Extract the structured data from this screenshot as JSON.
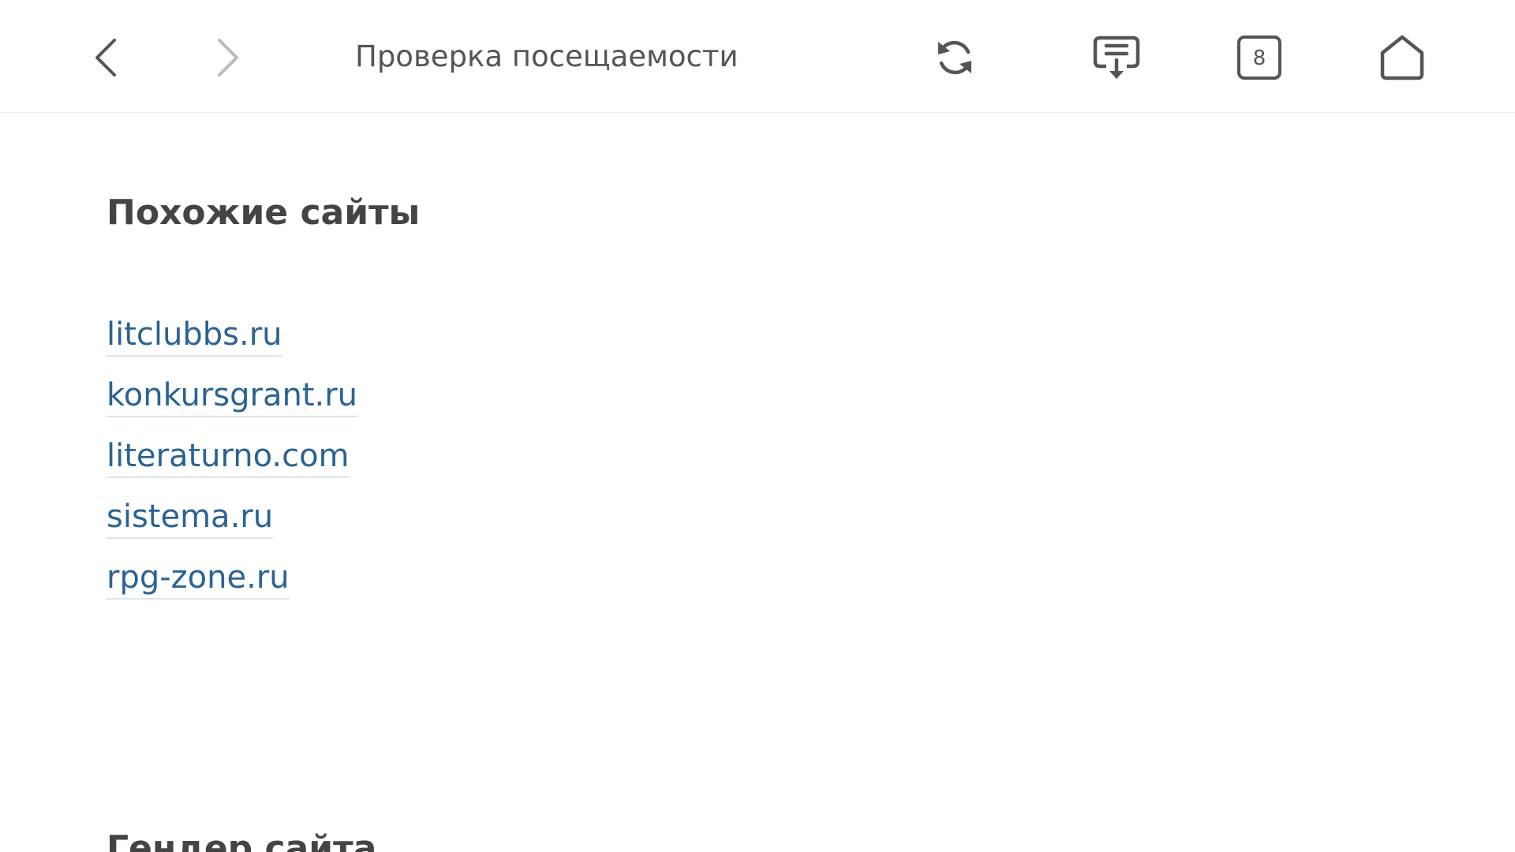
{
  "toolbar": {
    "title": "Проверка посещаемости",
    "tabs_count": "8",
    "icons": {
      "back": "chevron-left-icon",
      "forward": "chevron-right-icon",
      "reload": "reload-icon",
      "reader": "reader-download-icon",
      "tabs": "tabs-icon",
      "home": "home-icon"
    }
  },
  "similar_sites": {
    "heading": "Похожие сайты",
    "links": [
      "litclubbs.ru",
      "konkursgrant.ru",
      "literaturno.com",
      "sistema.ru",
      "rpg-zone.ru"
    ]
  },
  "next_section": {
    "heading": "Гендер сайта"
  },
  "colors": {
    "link": "#2a6393",
    "heading": "#444444",
    "toolbar_text": "#555555"
  }
}
